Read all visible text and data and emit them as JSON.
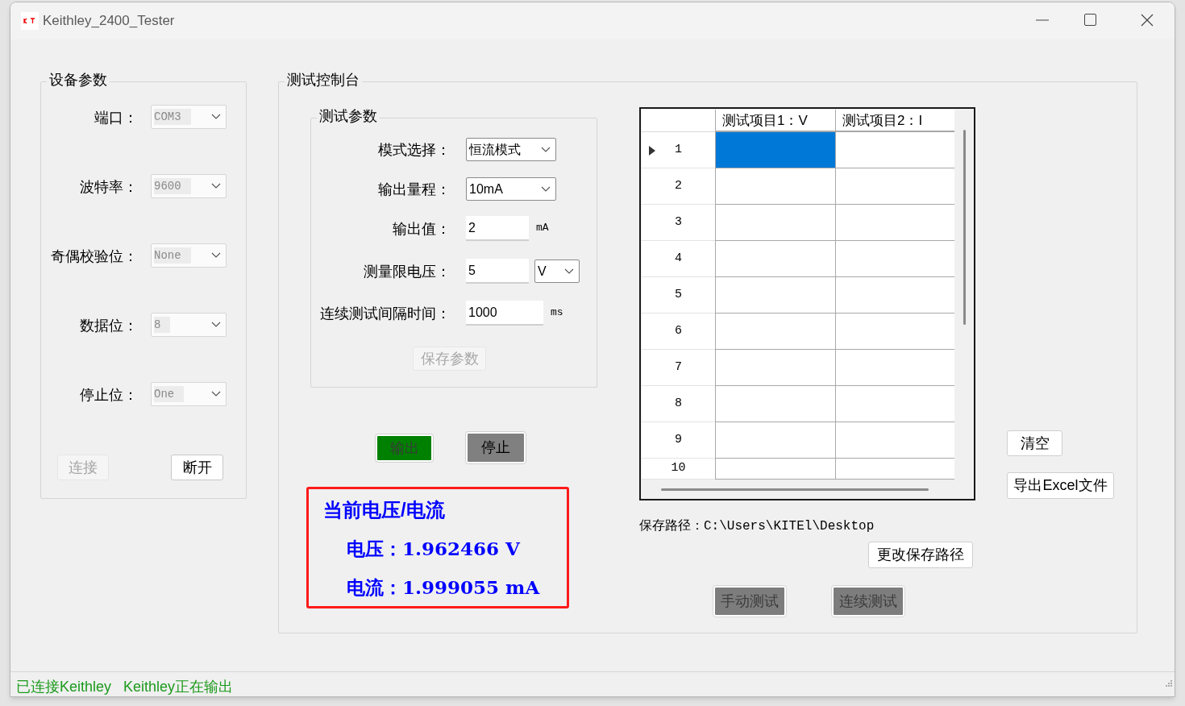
{
  "window": {
    "title": "Keithley_2400_Tester"
  },
  "device_group": {
    "title": "设备参数",
    "fields": [
      {
        "label": "端口：",
        "value": "COM3",
        "disabled": true
      },
      {
        "label": "波特率：",
        "value": "9600",
        "disabled": true
      },
      {
        "label": "奇偶校验位：",
        "value": "None",
        "disabled": true
      },
      {
        "label": "数据位：",
        "value": "8",
        "disabled": true
      },
      {
        "label": "停止位：",
        "value": "One",
        "disabled": true
      }
    ],
    "buttons": [
      {
        "label": "连接",
        "disabled": true
      },
      {
        "label": "断开",
        "disabled": false
      }
    ]
  },
  "console": {
    "title": "测试控制台",
    "params": {
      "title": "测试参数",
      "fields": [
        {
          "kind": "combo",
          "label": "模式选择：",
          "value": "恒流模式"
        },
        {
          "kind": "combo",
          "label": "输出量程：",
          "value": "10mA"
        },
        {
          "kind": "input",
          "label": "输出值：",
          "value": "2",
          "unit": "mA"
        },
        {
          "kind": "input_combo",
          "label": "测量限电压：",
          "value": "5",
          "unit": "V"
        },
        {
          "kind": "input",
          "label": "连续测试间隔时间：",
          "value": "1000",
          "unit": "ms"
        }
      ],
      "save_button": {
        "label": "保存参数",
        "disabled": true
      }
    },
    "output_buttons": [
      {
        "label": "输出",
        "color": "#008000"
      },
      {
        "label": "停止",
        "color": "#808080"
      }
    ],
    "readout": {
      "title": "当前电压/电流",
      "lines": [
        "电压：1.962466 V",
        "电流：1.999055 mA"
      ]
    },
    "table": {
      "columns": [
        "测试项目1：V",
        "测试项目2：I"
      ],
      "rows": [
        {
          "header": "1",
          "current": true,
          "cells": [
            {
              "selected": true
            },
            {
              "selected": false
            }
          ]
        },
        {
          "header": "2",
          "current": false,
          "cells": [
            {
              "selected": false
            },
            {
              "selected": false
            }
          ]
        },
        {
          "header": "3",
          "current": false,
          "cells": [
            {
              "selected": false
            },
            {
              "selected": false
            }
          ]
        },
        {
          "header": "4",
          "current": false,
          "cells": [
            {
              "selected": false
            },
            {
              "selected": false
            }
          ]
        },
        {
          "header": "5",
          "current": false,
          "cells": [
            {
              "selected": false
            },
            {
              "selected": false
            }
          ]
        },
        {
          "header": "6",
          "current": false,
          "cells": [
            {
              "selected": false
            },
            {
              "selected": false
            }
          ]
        },
        {
          "header": "7",
          "current": false,
          "cells": [
            {
              "selected": false
            },
            {
              "selected": false
            }
          ]
        },
        {
          "header": "8",
          "current": false,
          "cells": [
            {
              "selected": false
            },
            {
              "selected": false
            }
          ]
        },
        {
          "header": "9",
          "current": false,
          "cells": [
            {
              "selected": false
            },
            {
              "selected": false
            }
          ]
        },
        {
          "header": "10",
          "current": false,
          "cells": [
            {
              "selected": false
            },
            {
              "selected": false
            }
          ]
        }
      ]
    },
    "side_buttons": [
      "清空",
      "导出Excel文件"
    ],
    "save_path": "保存路径：C:\\Users\\KITEl\\Desktop",
    "change_path_button": "更改保存路径",
    "test_buttons": [
      "手动测试",
      "连续测试"
    ]
  },
  "status_bar": [
    "已连接Keithley",
    "Keithley正在输出"
  ]
}
